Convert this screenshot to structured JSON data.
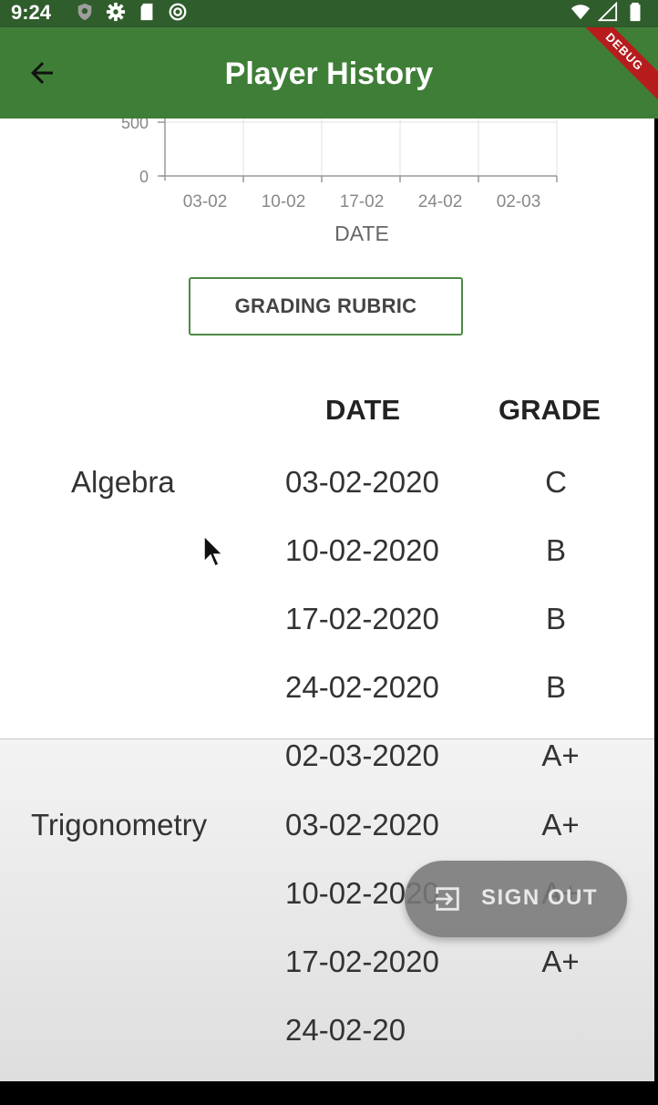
{
  "status_bar": {
    "time": "9:24",
    "left_icons": [
      "shield-icon",
      "gear-icon",
      "sd-card-icon",
      "sync-icon"
    ],
    "right_icons": [
      "wifi-icon",
      "signal-icon",
      "battery-icon"
    ]
  },
  "app_bar": {
    "title": "Player History",
    "back_icon": "arrow-back-icon",
    "debug_banner": "DEBUG",
    "color": "#3f7e37"
  },
  "chart_data": {
    "type": "line",
    "y_ticks": [
      "500",
      "0"
    ],
    "x_tick_labels": [
      "03-02",
      "10-02",
      "17-02",
      "24-02",
      "02-03"
    ],
    "xlabel": "DATE",
    "grid": true
  },
  "rubric_button": {
    "label": "GRADING RUBRIC"
  },
  "table": {
    "headers": {
      "date": "DATE",
      "grade": "GRADE"
    },
    "groups": [
      {
        "subject": "Algebra",
        "rows": [
          {
            "date": "03-02-2020",
            "grade": "C"
          },
          {
            "date": "10-02-2020",
            "grade": "B"
          },
          {
            "date": "17-02-2020",
            "grade": "B"
          },
          {
            "date": "24-02-2020",
            "grade": "B"
          },
          {
            "date": "02-03-2020",
            "grade": "A+"
          }
        ]
      },
      {
        "subject": "Trigonometry",
        "rows": [
          {
            "date": "03-02-2020",
            "grade": "A+"
          },
          {
            "date": "10-02-2020",
            "grade": "A+"
          },
          {
            "date": "17-02-2020",
            "grade": "A+"
          },
          {
            "date": "24-02-20",
            "grade": ""
          }
        ]
      }
    ]
  },
  "fab": {
    "label": "SIGN OUT",
    "icon": "exit-icon"
  }
}
